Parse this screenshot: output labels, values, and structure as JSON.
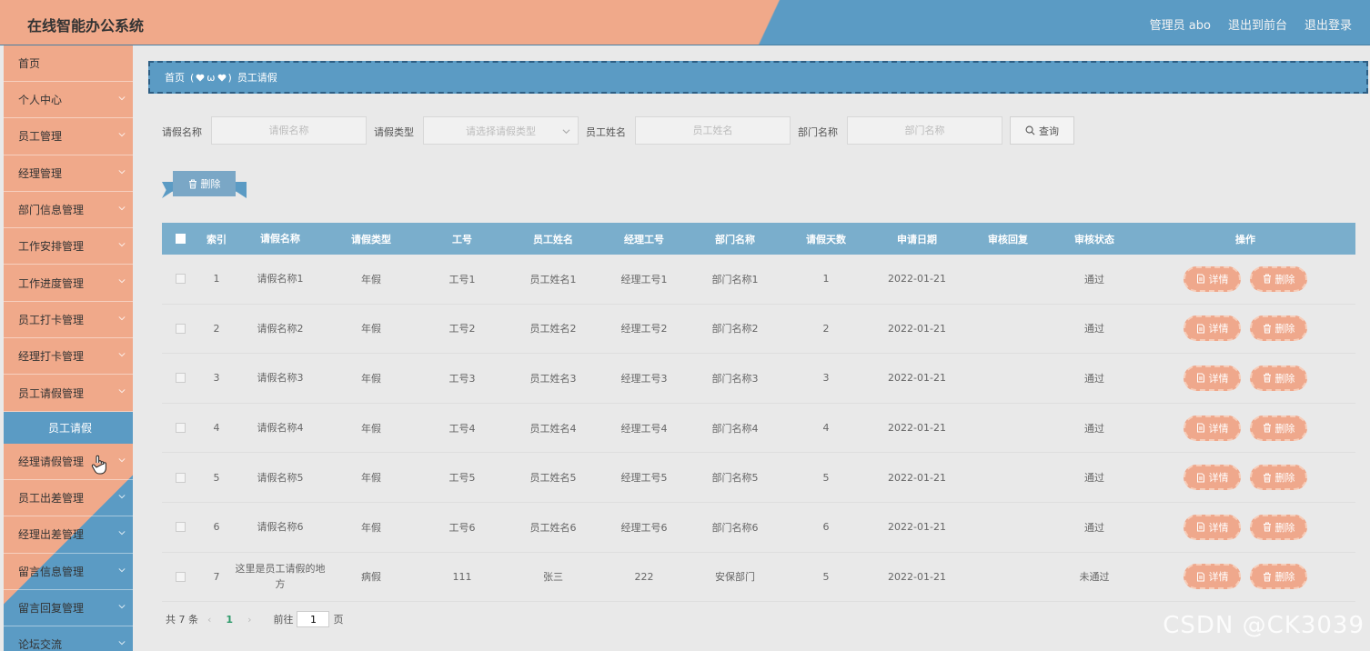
{
  "header": {
    "title": "在线智能办公系统",
    "admin_label": "管理员 abo",
    "to_front": "退出到前台",
    "logout": "退出登录"
  },
  "sidebar": {
    "items": [
      {
        "label": "首页"
      },
      {
        "label": "个人中心"
      },
      {
        "label": "员工管理"
      },
      {
        "label": "经理管理"
      },
      {
        "label": "部门信息管理"
      },
      {
        "label": "工作安排管理"
      },
      {
        "label": "工作进度管理"
      },
      {
        "label": "员工打卡管理"
      },
      {
        "label": "经理打卡管理"
      },
      {
        "label": "员工请假管理"
      },
      {
        "label": "经理请假管理"
      },
      {
        "label": "员工出差管理"
      },
      {
        "label": "经理出差管理"
      },
      {
        "label": "留言信息管理"
      },
      {
        "label": "留言回复管理"
      },
      {
        "label": "论坛交流"
      }
    ],
    "active_sub": "员工请假"
  },
  "breadcrumb": {
    "home": "首页",
    "separator": "ω",
    "current": "员工请假"
  },
  "search": {
    "leave_name_label": "请假名称",
    "leave_name_placeholder": "请假名称",
    "leave_type_label": "请假类型",
    "leave_type_placeholder": "请选择请假类型",
    "emp_name_label": "员工姓名",
    "emp_name_placeholder": "员工姓名",
    "dept_label": "部门名称",
    "dept_placeholder": "部门名称",
    "query_label": "查询"
  },
  "toolbar": {
    "delete_label": "删除"
  },
  "table": {
    "headers": [
      "索引",
      "请假名称",
      "请假类型",
      "工号",
      "员工姓名",
      "经理工号",
      "部门名称",
      "请假天数",
      "申请日期",
      "审核回复",
      "审核状态",
      "操作"
    ],
    "detail_label": "详情",
    "delete_label": "删除",
    "rows": [
      {
        "idx": "1",
        "name": "请假名称1",
        "type": "年假",
        "no": "工号1",
        "emp": "员工姓名1",
        "mgr": "经理工号1",
        "dept": "部门名称1",
        "days": "1",
        "date": "2022-01-21",
        "reply": "",
        "status": "通过"
      },
      {
        "idx": "2",
        "name": "请假名称2",
        "type": "年假",
        "no": "工号2",
        "emp": "员工姓名2",
        "mgr": "经理工号2",
        "dept": "部门名称2",
        "days": "2",
        "date": "2022-01-21",
        "reply": "",
        "status": "通过"
      },
      {
        "idx": "3",
        "name": "请假名称3",
        "type": "年假",
        "no": "工号3",
        "emp": "员工姓名3",
        "mgr": "经理工号3",
        "dept": "部门名称3",
        "days": "3",
        "date": "2022-01-21",
        "reply": "",
        "status": "通过"
      },
      {
        "idx": "4",
        "name": "请假名称4",
        "type": "年假",
        "no": "工号4",
        "emp": "员工姓名4",
        "mgr": "经理工号4",
        "dept": "部门名称4",
        "days": "4",
        "date": "2022-01-21",
        "reply": "",
        "status": "通过"
      },
      {
        "idx": "5",
        "name": "请假名称5",
        "type": "年假",
        "no": "工号5",
        "emp": "员工姓名5",
        "mgr": "经理工号5",
        "dept": "部门名称5",
        "days": "5",
        "date": "2022-01-21",
        "reply": "",
        "status": "通过"
      },
      {
        "idx": "6",
        "name": "请假名称6",
        "type": "年假",
        "no": "工号6",
        "emp": "员工姓名6",
        "mgr": "经理工号6",
        "dept": "部门名称6",
        "days": "6",
        "date": "2022-01-21",
        "reply": "",
        "status": "通过"
      },
      {
        "idx": "7",
        "name": "这里是员工请假的地方",
        "type": "病假",
        "no": "111",
        "emp": "张三",
        "mgr": "222",
        "dept": "安保部门",
        "days": "5",
        "date": "2022-01-21",
        "reply": "",
        "status": "未通过"
      }
    ]
  },
  "pagination": {
    "total": "共 7 条",
    "current_page": "1",
    "goto_label": "前往",
    "goto_value": "1",
    "page_suffix": "页"
  },
  "watermark": "CSDN @CK3039",
  "colors": {
    "orange": "#f0a98a",
    "blue": "#5b9bc4",
    "table_header": "#7aaecc"
  }
}
